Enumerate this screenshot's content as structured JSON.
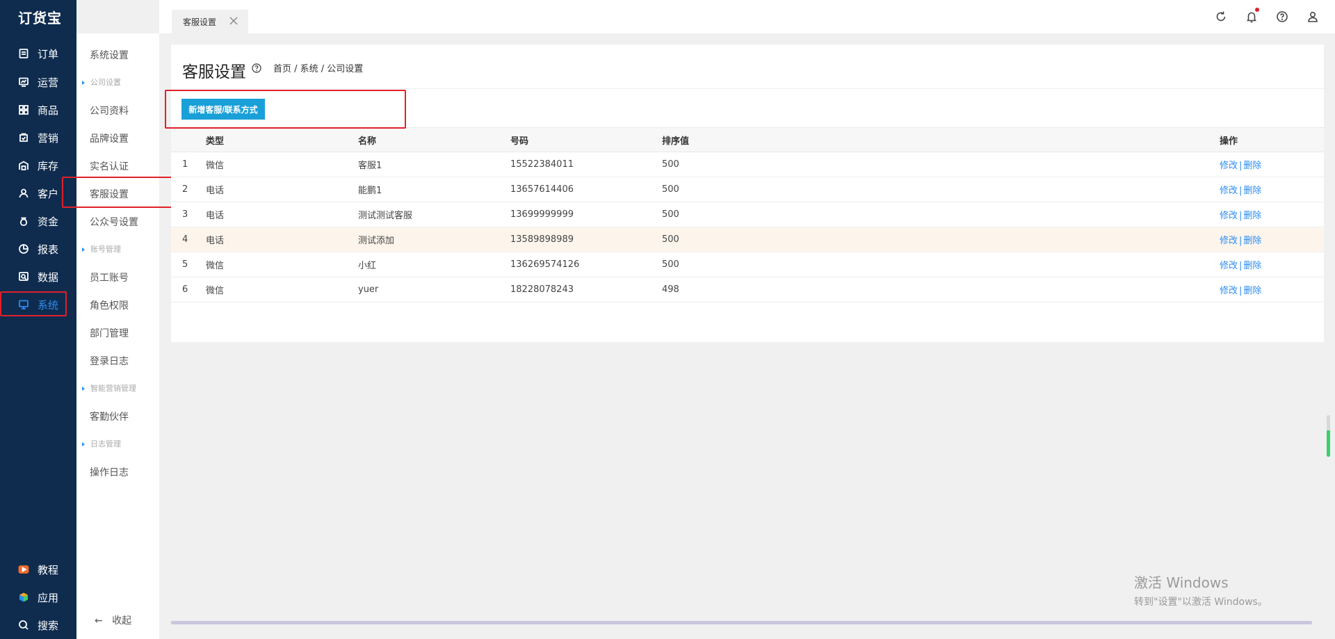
{
  "app": {
    "logo": "订货宝"
  },
  "nav": {
    "items": [
      {
        "label": "订单",
        "icon": "order-icon"
      },
      {
        "label": "运营",
        "icon": "operation-icon"
      },
      {
        "label": "商品",
        "icon": "grid-icon"
      },
      {
        "label": "营销",
        "icon": "marketing-icon"
      },
      {
        "label": "库存",
        "icon": "warehouse-icon"
      },
      {
        "label": "客户",
        "icon": "user-icon"
      },
      {
        "label": "资金",
        "icon": "money-bag-icon"
      },
      {
        "label": "报表",
        "icon": "pie-chart-icon"
      },
      {
        "label": "数据",
        "icon": "data-icon"
      },
      {
        "label": "系统",
        "icon": "monitor-icon",
        "active": true
      }
    ],
    "bottom": [
      {
        "label": "教程",
        "icon": "video-icon"
      },
      {
        "label": "应用",
        "icon": "cube-icon"
      },
      {
        "label": "搜索",
        "icon": "search-icon"
      }
    ]
  },
  "submenu": {
    "system_settings": "系统设置",
    "group_company": "公司设置",
    "company_info": "公司资料",
    "brand_settings": "品牌设置",
    "realname_auth": "实名认证",
    "customer_service": "客服设置",
    "official_account": "公众号设置",
    "group_account": "账号管理",
    "staff_account": "员工账号",
    "role_permission": "角色权限",
    "dept_management": "部门管理",
    "login_log": "登录日志",
    "group_smart_marketing": "智能营销管理",
    "partner": "客勤伙伴",
    "group_log": "日志管理",
    "operation_log": "操作日志",
    "collapse": "收起"
  },
  "tabs": [
    {
      "label": "客服设置"
    }
  ],
  "page": {
    "title": "客服设置",
    "breadcrumb": "首页 / 系统 / 公司设置",
    "add_button": "新增客服/联系方式"
  },
  "table": {
    "headers": {
      "type": "类型",
      "name": "名称",
      "number": "号码",
      "sort": "排序值",
      "action": "操作"
    },
    "edit_label": "修改",
    "delete_label": "删除",
    "sep": "|",
    "rows": [
      {
        "idx": "1",
        "type": "微信",
        "name": "客服1",
        "number": "15522384011",
        "sort": "500"
      },
      {
        "idx": "2",
        "type": "电话",
        "name": "能鹏1",
        "number": "13657614406",
        "sort": "500"
      },
      {
        "idx": "3",
        "type": "电话",
        "name": "测试测试客服",
        "number": "13699999999",
        "sort": "500"
      },
      {
        "idx": "4",
        "type": "电话",
        "name": "测试添加",
        "number": "13589898989",
        "sort": "500"
      },
      {
        "idx": "5",
        "type": "微信",
        "name": "小红",
        "number": "136269574126",
        "sort": "500"
      },
      {
        "idx": "6",
        "type": "微信",
        "name": "yuer",
        "number": "18228078243",
        "sort": "498"
      }
    ]
  },
  "watermark": {
    "line1": "激活 Windows",
    "line2": "转到\"设置\"以激活 Windows。"
  },
  "colors": {
    "nav_bg": "#0f2c4f",
    "accent": "#2d8cf0",
    "button": "#1aa0d8",
    "highlight_box": "#e0202a"
  }
}
